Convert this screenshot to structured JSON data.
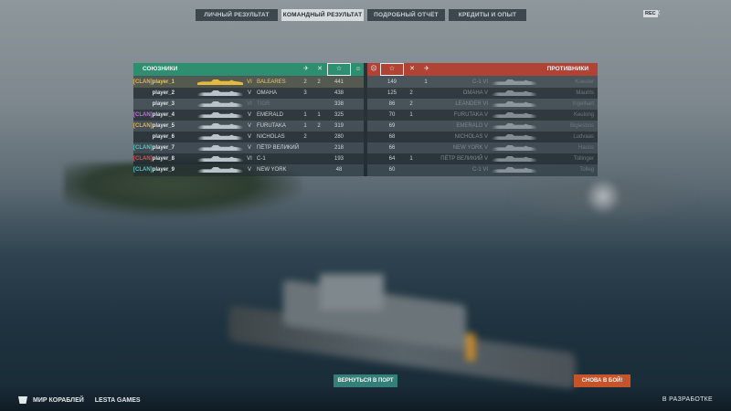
{
  "tabs": [
    {
      "label": "ЛИЧНЫЙ РЕЗУЛЬТАТ",
      "active": false
    },
    {
      "label": "КОМАНДНЫЙ РЕЗУЛЬТАТ",
      "active": true
    },
    {
      "label": "ПОДРОБНЫЙ ОТЧЁТ",
      "active": false
    },
    {
      "label": "КРЕДИТЫ И ОПЫТ",
      "active": false
    }
  ],
  "rec_badge": "REC",
  "close_glyph": "✕",
  "allies": {
    "title": "СОЮЗНИКИ",
    "color": "#2d8f6f",
    "rows": [
      {
        "clan": "[CLAN]",
        "player": "player_1",
        "tier": "VI",
        "ship": "BALEARES",
        "c1": "2",
        "c2": "2",
        "score": "441",
        "mine": true
      },
      {
        "clan": "",
        "player": "player_2",
        "tier": "V",
        "ship": "OMAHA",
        "c1": "3",
        "c2": "",
        "score": "438"
      },
      {
        "clan": "",
        "player": "player_3",
        "tier": "VI",
        "ship": "TIGR",
        "c1": "",
        "c2": "",
        "score": "338"
      },
      {
        "clan": "[CLAN]",
        "player": "player_4",
        "tier": "V",
        "ship": "EMERALD",
        "c1": "1",
        "c2": "1",
        "score": "325"
      },
      {
        "clan": "[CLAN]",
        "player": "player_5",
        "tier": "V",
        "ship": "FURUTAKA",
        "c1": "1",
        "c2": "2",
        "score": "319"
      },
      {
        "clan": "",
        "player": "player_6",
        "tier": "V",
        "ship": "NICHOLAS",
        "c1": "2",
        "c2": "",
        "score": "280"
      },
      {
        "clan": "[CLAN]",
        "player": "player_7",
        "tier": "V",
        "ship": "ПЁТР ВЕЛИКИЙ",
        "c1": "",
        "c2": "",
        "score": "218"
      },
      {
        "clan": "[CLAN]",
        "player": "player_8",
        "tier": "VI",
        "ship": "C-1",
        "c1": "",
        "c2": "",
        "score": "193"
      },
      {
        "clan": "[CLAN]",
        "player": "player_9",
        "tier": "V",
        "ship": "NEW YORK",
        "c1": "",
        "c2": "",
        "score": "48"
      }
    ]
  },
  "enemies": {
    "title": "ПРОТИВНИКИ",
    "color": "#b04334",
    "rows": [
      {
        "score": "149",
        "c1": "",
        "c2": "1",
        "ship": "C-1 VI",
        "player": "Koester"
      },
      {
        "score": "125",
        "c1": "2",
        "c2": "",
        "ship": "OMAHA V",
        "player": "Maurits"
      },
      {
        "score": "86",
        "c1": "2",
        "c2": "",
        "ship": "LEANDER VI",
        "player": "Ingelhart"
      },
      {
        "score": "70",
        "c1": "1",
        "c2": "",
        "ship": "FURUTAKA V",
        "player": "Keulong"
      },
      {
        "score": "69",
        "c1": "",
        "c2": "",
        "ship": "EMERALD V",
        "player": "Biglesbos"
      },
      {
        "score": "68",
        "c1": "",
        "c2": "",
        "ship": "NICHOLAS V",
        "player": "Ludvaas"
      },
      {
        "score": "66",
        "c1": "",
        "c2": "",
        "ship": "NEW YORK V",
        "player": "Hauss"
      },
      {
        "score": "64",
        "c1": "1",
        "c2": "",
        "ship": "ПЁТР ВЕЛИКИЙ V",
        "player": "Tollinger"
      },
      {
        "score": "60",
        "c1": "",
        "c2": "",
        "ship": "C-1 VI",
        "player": "Tolleg"
      }
    ]
  },
  "star_glyph": "☆",
  "buttons": {
    "port": "ВЕРНУТЬСЯ В ПОРТ",
    "battle": "СНОВА В БОЙ!"
  },
  "footer": {
    "brand": "МИР КОРАБЛЕЙ",
    "publisher": "LESTA GAMES",
    "status": "В РАЗРАБОТКЕ"
  }
}
